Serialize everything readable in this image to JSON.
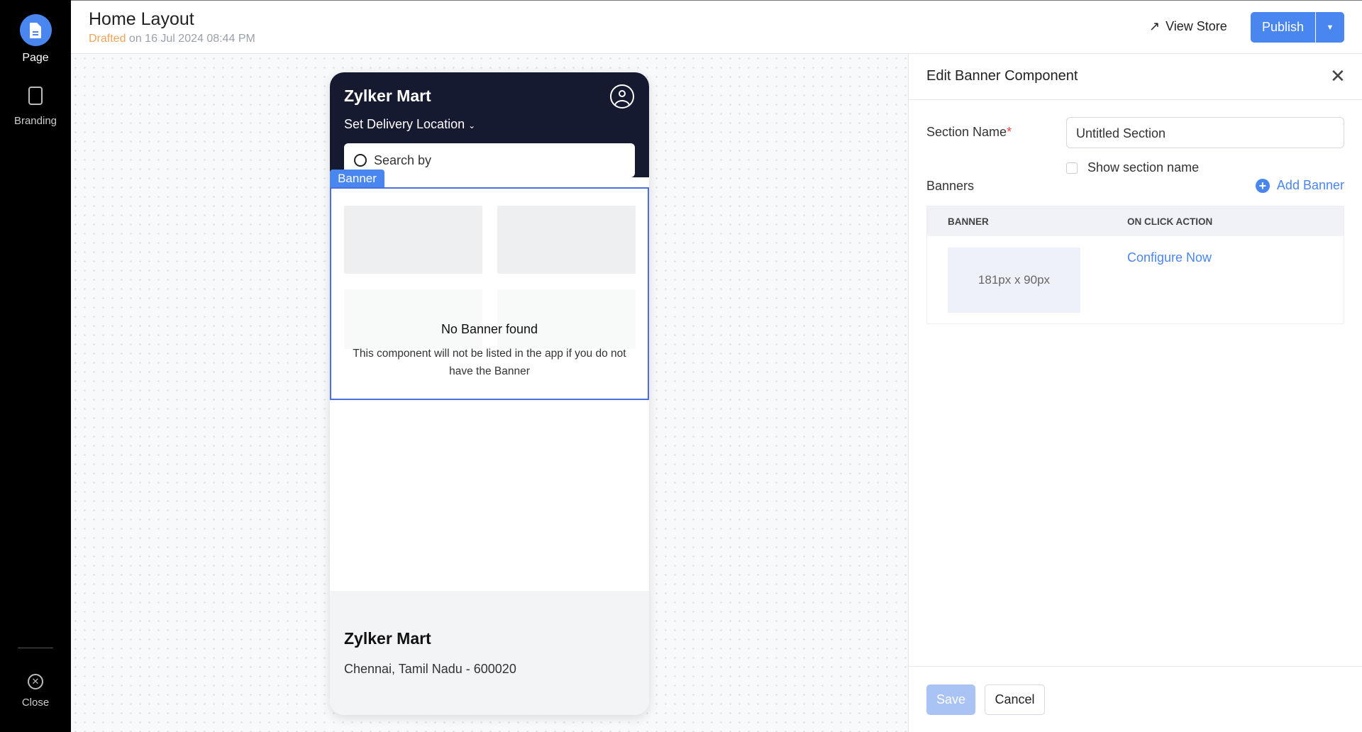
{
  "sidebar": {
    "items": [
      {
        "label": "Page",
        "icon": "page-icon"
      },
      {
        "label": "Branding",
        "icon": "branding-icon"
      }
    ],
    "close_label": "Close"
  },
  "header": {
    "title": "Home Layout",
    "status": "Drafted",
    "status_suffix": "on 16 Jul 2024 08:44 PM",
    "view_store": "View Store",
    "publish": "Publish"
  },
  "preview": {
    "store_name": "Zylker Mart",
    "delivery": "Set Delivery Location",
    "search_placeholder": "Search by",
    "banner_tag": "Banner",
    "empty_title": "No Banner found",
    "empty_desc": "This component will not be listed in the app if you do not have the Banner",
    "footer_name": "Zylker Mart",
    "footer_address": "Chennai, Tamil Nadu - 600020"
  },
  "panel": {
    "title": "Edit Banner Component",
    "section_name_label": "Section Name",
    "required_mark": "*",
    "section_name_value": "Untitled Section",
    "show_section_name": "Show section name",
    "banners_label": "Banners",
    "add_banner": "Add Banner",
    "table": {
      "headers": [
        "BANNER",
        "ON CLICK ACTION"
      ],
      "rows": [
        {
          "banner": "181px x 90px",
          "action": "Configure Now"
        }
      ]
    },
    "save": "Save",
    "cancel": "Cancel"
  },
  "colors": {
    "accent": "#4a7cf0",
    "sidebar": "#000000",
    "phone_header": "#161a30",
    "drafted": "#f0a35a"
  }
}
